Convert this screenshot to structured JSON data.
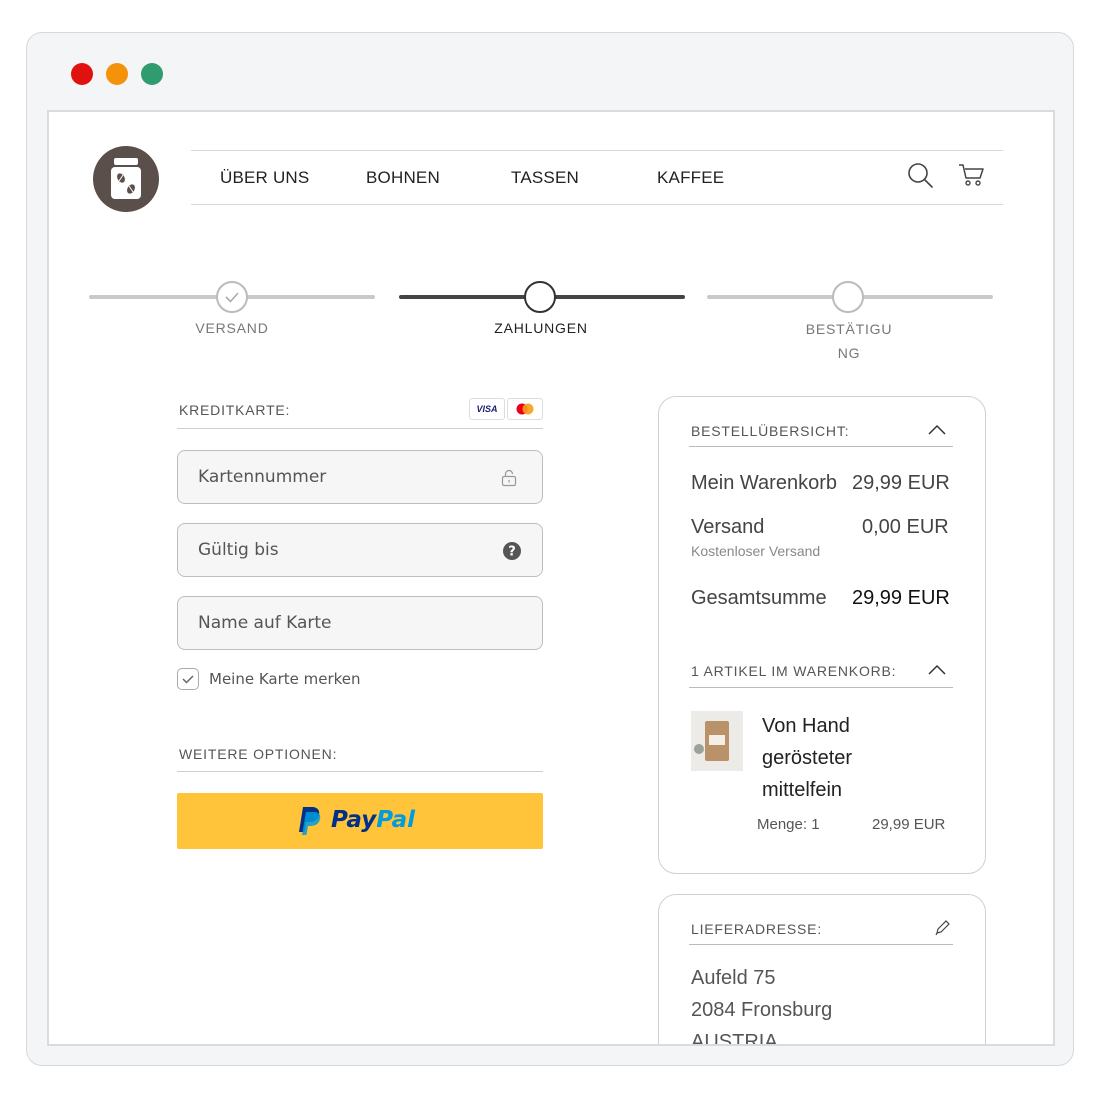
{
  "nav": {
    "items": [
      "ÜBER UNS",
      "BOHNEN",
      "TASSEN",
      "KAFFEE"
    ]
  },
  "icons": {
    "logo": "coffee-jar-logo",
    "search": "search-icon",
    "cart": "cart-icon",
    "check": "check-icon",
    "lock": "lock-icon",
    "help": "help-icon",
    "chevron": "chevron-up-icon",
    "edit": "pencil-icon"
  },
  "steps": [
    {
      "label": "VERSAND",
      "state": "done"
    },
    {
      "label": "ZAHLUNGEN",
      "state": "active"
    },
    {
      "label": "BESTÄTIGU\nNG",
      "state": "pending"
    }
  ],
  "payment": {
    "creditcard_label": "KREDITKARTE:",
    "card_badges": [
      "VISA",
      "mastercard"
    ],
    "card_number_placeholder": "Kartennummer",
    "expiry_placeholder": "Gültig bis",
    "name_placeholder": "Name auf Karte",
    "remember_label": "Meine Karte merken",
    "remember_checked": true,
    "more_options_label": "WEITERE OPTIONEN:",
    "paypal_label_pay": "Pay",
    "paypal_label_pal": "Pal"
  },
  "summary": {
    "title": "BESTELLÜBERSICHT:",
    "cart_label": "Mein Warenkorb",
    "cart_value": "29,99 EUR",
    "shipping_label": "Versand",
    "shipping_value": "0,00 EUR",
    "shipping_note": "Kostenloser Versand",
    "total_label": "Gesamtsumme",
    "total_value": "29,99 EUR",
    "items_title": "1 ARTIKEL IM WARENKORB:",
    "item_name": "Von Hand gerösteter mittelfein",
    "item_qty": "Menge: 1",
    "item_price": "29,99 EUR"
  },
  "address": {
    "title": "LIEFERADRESSE:",
    "line1": "Aufeld 75",
    "line2": "2084 Fronsburg",
    "line3": "AUSTRIA"
  },
  "colors": {
    "accent_dark": "#444444",
    "paypal_yellow": "#FFC439",
    "logo_bg": "#5a4f4a"
  }
}
